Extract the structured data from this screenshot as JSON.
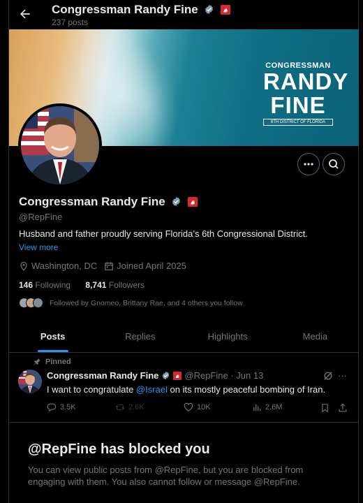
{
  "header": {
    "name": "Congressman Randy Fine",
    "posts_count": "237 posts"
  },
  "banner": {
    "logo_line1": "CONGRESSMAN",
    "logo_line2": "RANDY",
    "logo_line3": "FINE",
    "logo_line4": "6TH DISTRICT OF FLORIDA"
  },
  "profile": {
    "name": "Congressman Randy Fine",
    "handle": "@RepFine",
    "bio": "Husband and father proudly serving Florida’s 6th Congressional District.",
    "view_more": "View more",
    "location": "Washington, DC",
    "joined": "Joined April 2025",
    "following_count": "146",
    "following_label": "Following",
    "followers_count": "8,741",
    "followers_label": "Followers",
    "followed_by": "Followed by Gnomeo, Brittany Rae, and 4 others you follow"
  },
  "tabs": [
    "Posts",
    "Replies",
    "Highlights",
    "Media"
  ],
  "pinned_tweet": {
    "pinned_label": "Pinned",
    "author": "Congressman Randy Fine",
    "meta": "@RepFine · Jun 13",
    "text_before": "I want to congratulate ",
    "mention": "@Israel",
    "text_after": " on its mostly peaceful bombing of Iran.",
    "replies": "3.5K",
    "reposts": "2.6K",
    "likes": "10K",
    "views": "2.6M"
  },
  "blocked": {
    "title": "@RepFine has blocked you",
    "text": "You can view public posts from @RepFine, but you are blocked from engaging with them. You also cannot follow or message @RepFine."
  },
  "colors": {
    "accent": "#1d9bf0",
    "verified_gray": "#829aab",
    "party_badge": "#d22a34",
    "background": "#000000",
    "muted": "#71767b"
  }
}
